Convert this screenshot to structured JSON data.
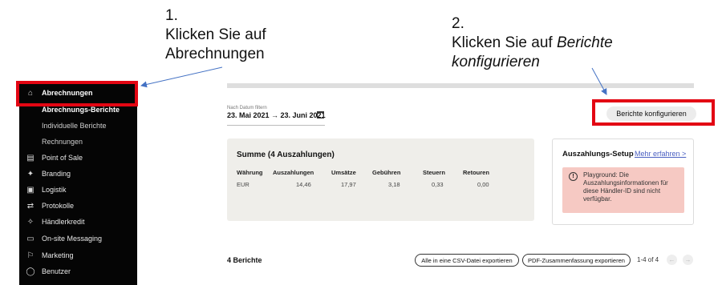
{
  "annotations": {
    "step1": {
      "number": "1.",
      "line1": "Klicken Sie auf",
      "line2": "Abrechnungen"
    },
    "step2": {
      "number": "2.",
      "line1_prefix": "Klicken Sie auf ",
      "line1_em": "Berichte",
      "line2_em": "konfigurieren"
    }
  },
  "sidebar": {
    "items": [
      {
        "label": "Abrechnungen",
        "icon": "bank-icon",
        "glyph": "⌂",
        "type": "active"
      },
      {
        "label": "Abrechnungs-Berichte",
        "type": "sub-bold"
      },
      {
        "label": "Individuelle Berichte",
        "type": "sub"
      },
      {
        "label": "Rechnungen",
        "type": "sub"
      },
      {
        "label": "Point of Sale",
        "icon": "store-icon",
        "glyph": "▤",
        "type": "main"
      },
      {
        "label": "Branding",
        "icon": "brush-icon",
        "glyph": "✦",
        "type": "main"
      },
      {
        "label": "Logistik",
        "icon": "box-icon",
        "glyph": "▣",
        "type": "main"
      },
      {
        "label": "Protokolle",
        "icon": "exchange-icon",
        "glyph": "⇄",
        "type": "main"
      },
      {
        "label": "Händlerkredit",
        "icon": "handshake-icon",
        "glyph": "✧",
        "type": "main"
      },
      {
        "label": "On-site Messaging",
        "icon": "message-icon",
        "glyph": "▭",
        "type": "main"
      },
      {
        "label": "Marketing",
        "icon": "megaphone-icon",
        "glyph": "⚐",
        "type": "main"
      },
      {
        "label": "Benutzer",
        "icon": "user-icon",
        "glyph": "◯",
        "type": "main"
      }
    ]
  },
  "date_filter": {
    "caption": "Nach Datum filtern",
    "value": "23. Mai 2021 → 23. Juni 2021"
  },
  "configure_button": "Berichte konfigurieren",
  "summary": {
    "title": "Summe (4 Auszahlungen)",
    "headers": [
      "Währung",
      "Auszahlungen",
      "Umsätze",
      "Gebühren",
      "Steuern",
      "Retouren"
    ],
    "row": [
      "EUR",
      "14,46",
      "17,97",
      "3,18",
      "0,33",
      "0,00"
    ]
  },
  "setup": {
    "title": "Auszahlungs-Setup",
    "link": "Mehr erfahren >",
    "alert_text": "Playground: Die Auszahlungsinformationen für diese Händler-ID sind nicht verfügbar."
  },
  "footer": {
    "count": "4 Berichte",
    "csv_button": "Alle in eine CSV-Datei exportieren",
    "pdf_button": "PDF-Zusammenfassung exportieren",
    "pagination": "1-4 of 4"
  },
  "colors": {
    "highlight": "#e30613",
    "arrow": "#4472c4",
    "sidebar_bg": "#050505",
    "alert_bg": "#f6c9c3",
    "link": "#4a5fc1"
  }
}
